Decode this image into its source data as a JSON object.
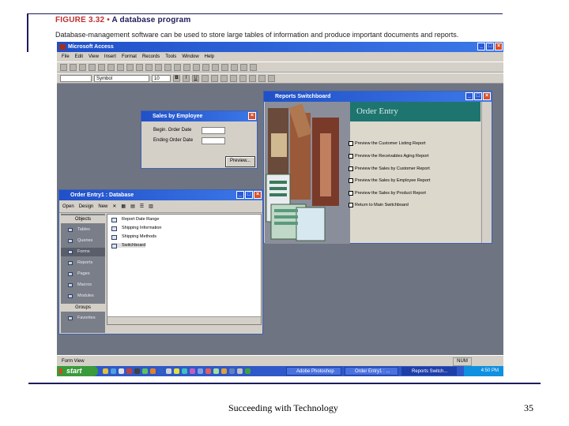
{
  "slide": {
    "figure_label": "FIGURE 3.32",
    "figure_sep": "•",
    "figure_title": "A database program",
    "caption": "Database-management software can be used to store large tables of information and produce important documents and reports.",
    "footer_text": "Succeeding with Technology",
    "page_number": "35"
  },
  "access": {
    "title": "Microsoft Access",
    "menu": [
      "File",
      "Edit",
      "View",
      "Insert",
      "Format",
      "Records",
      "Tools",
      "Window",
      "Help"
    ],
    "font_name": "Symbol",
    "font_size": "10",
    "format_buttons": [
      "B",
      "I",
      "U"
    ],
    "status": "Form View",
    "status_num": "NUM"
  },
  "sales_dialog": {
    "title": "Sales by Employee",
    "begin_label": "Begin. Order Date",
    "end_label": "Ending Order Date",
    "preview_button": "Preview..."
  },
  "switchboard": {
    "title": "Reports Switchboard",
    "header": "Order Entry",
    "items": [
      "Preview the Customer Listing Report",
      "Preview the Receivables Aging Report",
      "Preview the Sales by Customer Report",
      "Preview the Sales by Employee Report",
      "Preview the Sales by Product Report",
      "Return to Main Switchboard"
    ]
  },
  "db_window": {
    "title": "Order Entry1 : Database",
    "toolbar": {
      "open": "Open",
      "design": "Design",
      "new": "New"
    },
    "objects_header": "Objects",
    "objects": [
      "Tables",
      "Queries",
      "Forms",
      "Reports",
      "Pages",
      "Macros",
      "Modules"
    ],
    "groups_header": "Groups",
    "groups": [
      "Favorites"
    ],
    "forms": [
      "Report Date Range",
      "Shipping Information",
      "Shipping Methods",
      "Switchboard"
    ]
  },
  "taskbar": {
    "start": "start",
    "tasks": [
      "Adobe Photoshop",
      "Order Entry1 : ...",
      "Reports Switch..."
    ],
    "clock": "4:50 PM"
  },
  "colors": {
    "title_blue": "#2050c8",
    "workspace": "#6e7481",
    "switch_teal": "#1e7570",
    "taskbar": "#2f58c8",
    "start_green": "#3b9a3b"
  },
  "icons": [
    "windows-flag-icon",
    "close-icon",
    "maximize-icon",
    "minimize-icon",
    "checkbox-icon",
    "form-icon",
    "table-icon"
  ]
}
